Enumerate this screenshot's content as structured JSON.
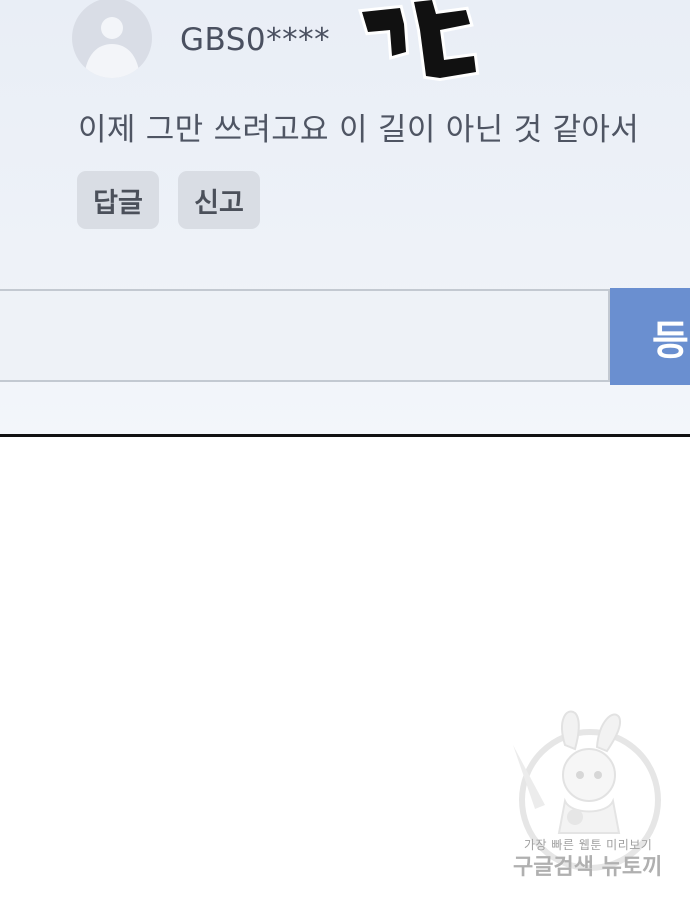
{
  "comment": {
    "username": "GBS0****",
    "text": "이제 그만 쓰려고요 이 길이 아닌 것 같아서",
    "reply_label": "답글",
    "report_label": "신고"
  },
  "composer": {
    "input_value": "",
    "submit_label": "등록"
  },
  "watermark": {
    "line1": "가장 빠른 웹툰 미리보기",
    "line2": "구글검색 뉴토끼"
  },
  "colors": {
    "panel_background": "#eef2f8",
    "chip_background": "#d9dde4",
    "submit_button": "#6a8fd0",
    "text": "#4f5563"
  }
}
